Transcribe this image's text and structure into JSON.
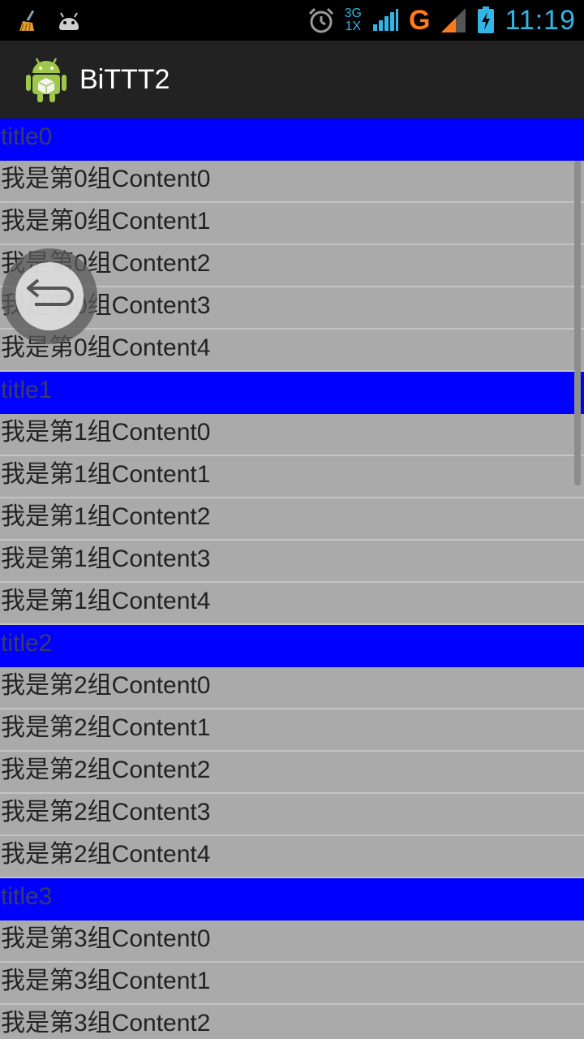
{
  "status_bar": {
    "left_icons": [
      "broom-icon",
      "android-debug-icon"
    ],
    "alarm_icon": "alarm-clock-icon",
    "net_top": "3G",
    "net_bottom": "1X",
    "signal_icon": "signal-bars-icon",
    "data_type": "G",
    "battery_icon": "battery-charging-icon",
    "time": "11:19"
  },
  "action_bar": {
    "icon": "android-app-icon",
    "title": "BiTTT2"
  },
  "groups": [
    {
      "title": "title0",
      "items": [
        "我是第0组Content0",
        "我是第0组Content1",
        "我是第0组Content2",
        "我是第0组Content3",
        "我是第0组Content4"
      ]
    },
    {
      "title": "title1",
      "items": [
        "我是第1组Content0",
        "我是第1组Content1",
        "我是第1组Content2",
        "我是第1组Content3",
        "我是第1组Content4"
      ]
    },
    {
      "title": "title2",
      "items": [
        "我是第2组Content0",
        "我是第2组Content1",
        "我是第2组Content2",
        "我是第2组Content3",
        "我是第2组Content4"
      ]
    },
    {
      "title": "title3",
      "items": [
        "我是第3组Content0",
        "我是第3组Content1",
        "我是第3组Content2"
      ]
    }
  ],
  "floating_button": {
    "icon": "back-arrow-icon"
  },
  "colors": {
    "group_title_bg": "#0000ff",
    "list_bg": "#aaaaaa",
    "action_bar_bg": "#222222",
    "status_accent": "#33b5e5",
    "data_type_color": "#ff7a1a"
  }
}
